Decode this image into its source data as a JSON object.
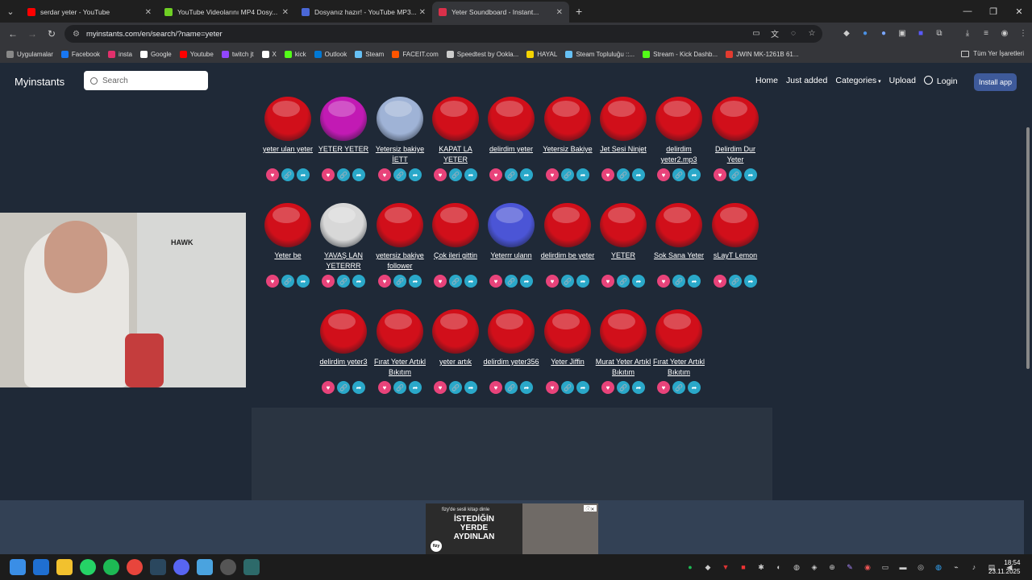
{
  "browser": {
    "tabs": [
      {
        "title": "serdar yeter - YouTube",
        "color": "#ff0000",
        "active": false
      },
      {
        "title": "YouTube Videolarını MP4 Dosy...",
        "color": "#6fcf24",
        "active": false
      },
      {
        "title": "Dosyanız hazır! - YouTube MP3...",
        "color": "#4a67d6",
        "active": false
      },
      {
        "title": "Yeter Soundboard - Instant...",
        "color": "#d9304a",
        "active": true
      }
    ],
    "url": "myinstants.com/en/search/?name=yeter",
    "bookmarks": [
      {
        "label": "Uygulamalar",
        "color": "#888"
      },
      {
        "label": "Facebook",
        "color": "#1877f2"
      },
      {
        "label": "insta",
        "color": "#e1306c"
      },
      {
        "label": "Google",
        "color": "#ffffff"
      },
      {
        "label": "Youtube",
        "color": "#ff0000"
      },
      {
        "label": "twitch jt",
        "color": "#9146ff"
      },
      {
        "label": "X",
        "color": "#ffffff"
      },
      {
        "label": "kick",
        "color": "#53fc18"
      },
      {
        "label": "Outlook",
        "color": "#0078d4"
      },
      {
        "label": "Steam",
        "color": "#66c0f4"
      },
      {
        "label": "FACEIT.com",
        "color": "#ff5500"
      },
      {
        "label": "Speedtest by Ookla...",
        "color": "#cccccc"
      },
      {
        "label": "HAYAL",
        "color": "#f5d300"
      },
      {
        "label": "Steam Topluluğu ::...",
        "color": "#66c0f4"
      },
      {
        "label": "Stream - Kick Dashb...",
        "color": "#53fc18"
      },
      {
        "label": "JWIN MK-1261B 61...",
        "color": "#e23b2f"
      }
    ],
    "all_bookmarks_label": "Tüm Yer İşaretleri"
  },
  "site": {
    "brand": "Myinstants",
    "search_placeholder": "Search",
    "nav": [
      "Home",
      "Just added",
      "Categories",
      "Upload",
      "Login"
    ],
    "install_label": "Install app"
  },
  "buttons": [
    {
      "label": "yeter ulan yeter",
      "color": "#d10f1a"
    },
    {
      "label": "YETER YETER",
      "color": "#c21ab4"
    },
    {
      "label": "Yetersiz bakiye İETT",
      "color": "#9fb3d6"
    },
    {
      "label": "KAPAT LA YETER",
      "color": "#d10f1a"
    },
    {
      "label": "delirdim yeter",
      "color": "#d10f1a"
    },
    {
      "label": "Yetersiz Bakiye",
      "color": "#d10f1a"
    },
    {
      "label": "Jet Sesi Ninjet",
      "color": "#d10f1a"
    },
    {
      "label": "delirdim yeter2.mp3",
      "color": "#d10f1a"
    },
    {
      "label": "Delirdim Dur Yeter",
      "color": "#d10f1a"
    },
    {
      "label": "Yeter be",
      "color": "#d10f1a"
    },
    {
      "label": "YAVAŞ LAN YETERRR",
      "color": "#d8d8d8"
    },
    {
      "label": "yetersiz bakiye follower",
      "color": "#d10f1a"
    },
    {
      "label": "Çok ileri gittin",
      "color": "#d10f1a"
    },
    {
      "label": "Yeterrr ulann",
      "color": "#4b55d6"
    },
    {
      "label": "delirdim be yeter",
      "color": "#d10f1a"
    },
    {
      "label": "YETER",
      "color": "#d10f1a"
    },
    {
      "label": "Sok Sana Yeter",
      "color": "#d10f1a"
    },
    {
      "label": "sLayT Lemon",
      "color": "#d10f1a"
    },
    {
      "label": "delirdim yeter3",
      "color": "#d10f1a"
    },
    {
      "label": "Fırat Yeter Artıkl Bıkıtım",
      "color": "#d10f1a"
    },
    {
      "label": "yeter artık",
      "color": "#d10f1a"
    },
    {
      "label": "delirdim yeter356",
      "color": "#d10f1a"
    },
    {
      "label": "Yeter Jiffin",
      "color": "#d10f1a"
    },
    {
      "label": "Murat Yeter Artıkl Bıkıtım",
      "color": "#d10f1a"
    },
    {
      "label": "Fırat Yeter Artıkl Bıkıtım",
      "color": "#d10f1a"
    }
  ],
  "ad": {
    "top": "fizy'de sesli kitap dinle",
    "line1": "İSTEDİĞİN",
    "line2": "YERDE",
    "line3": "AYDINLAN",
    "logo": "fizy"
  },
  "webcam": {
    "brand_text": "HAWK"
  },
  "clock": {
    "time": "18:54",
    "date": "23.11.2025"
  }
}
